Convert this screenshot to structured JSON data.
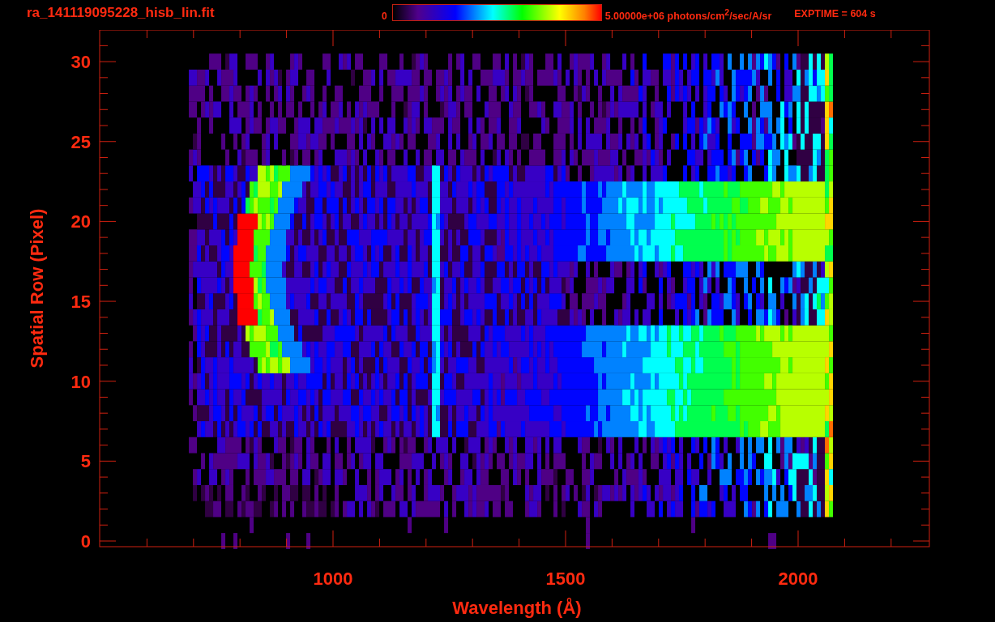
{
  "title": "ra_141119095228_hisb_lin.fit",
  "colorbar": {
    "min_label": "0",
    "max_label": "5.00000e+06 photons/cm$^{2}$/sec/A/sr"
  },
  "exposure": "EXPTIME = 604 s",
  "plot": {
    "xlabel": "Wavelength (Å)",
    "ylabel": "Spatial Row (Pixel)",
    "xticks": [
      "1000",
      "1500",
      "2000"
    ],
    "yticks": [
      "30",
      "25",
      "20",
      "15",
      "10",
      "5",
      "0"
    ]
  }
}
